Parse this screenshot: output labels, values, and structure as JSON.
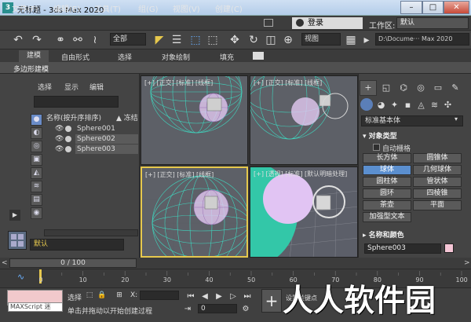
{
  "window": {
    "title": "无标题    - 3ds Max 2020",
    "app_icon": "3ds-max-icon",
    "controls": {
      "minimize": "–",
      "maximize": "□",
      "close": "✕"
    }
  },
  "menubar": {
    "items": [
      "文件(F)",
      "编辑(E)",
      "工具(T)",
      "组(G)",
      "视图(V)",
      "创建(C)"
    ],
    "login": "登录",
    "workspace_label": "工作区:",
    "workspace_value": "默认"
  },
  "toolbar": {
    "selection_filter": "全部",
    "view_dropdown": "视图",
    "project_path": "D:\\Docume··· Max 2020"
  },
  "ribbon": {
    "tabs": [
      "建模",
      "自由形式",
      "选择",
      "对象绘制",
      "填充"
    ],
    "active_tab": "建模",
    "sub_label": "多边形建模"
  },
  "scene_explorer": {
    "menu": [
      "选择",
      "显示",
      "编辑"
    ],
    "column_name": "名称(按升序排序)",
    "column_freeze": "▲ 冻结",
    "objects": [
      {
        "name": "Sphere001",
        "selected": false
      },
      {
        "name": "Sphere002",
        "selected": true
      },
      {
        "name": "Sphere003",
        "selected": true
      }
    ],
    "layer": "默认"
  },
  "viewports": [
    {
      "label": "[+] [正交] [标准] [线框]"
    },
    {
      "label": "[+] [正交] [标准] [线框]"
    },
    {
      "label": "[+] [正交] [标准] [线框]"
    },
    {
      "label": "[+] [透视] [标准] [默认明暗处理]"
    }
  ],
  "command_panel": {
    "dropdown": "标准基本体",
    "object_type_heading": "对象类型",
    "autogrid_label": "自动栅格",
    "buttons": [
      "长方体",
      "圆锥体",
      "球体",
      "几何球体",
      "圆柱体",
      "管状体",
      "圆环",
      "四棱锥",
      "茶壶",
      "平面",
      "加强型文本"
    ],
    "active_button": "球体",
    "name_color_heading": "名称和颜色",
    "name_value": "Sphere003",
    "object_color": "#f5c6d6"
  },
  "timeline": {
    "slider_text": "0 / 100",
    "ticks": [
      "0",
      "10",
      "20",
      "30",
      "40",
      "50",
      "60",
      "70",
      "80",
      "90",
      "100"
    ]
  },
  "statusbar": {
    "maxscript_label": "MAXScript 迷",
    "selection_text": "选择",
    "prompt": "单击并拖动以开始创建过程",
    "x_label": "X:",
    "frame_value": "0",
    "setkey_text": "设置关键点",
    "autokey_label": "+"
  },
  "watermark": "人人软件园",
  "colors": {
    "wire_teal": "#3fd6bf",
    "wire_purple": "#d7a8f2",
    "active_border": "#e6c84d",
    "selected_button": "#5b8fcf"
  }
}
